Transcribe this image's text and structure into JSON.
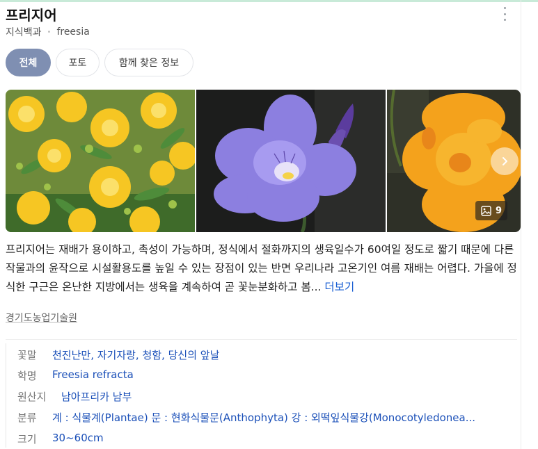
{
  "header": {
    "title": "프리지어",
    "subtitle_source": "지식백과",
    "subtitle_term": "freesia"
  },
  "tabs": [
    {
      "label": "전체",
      "active": true
    },
    {
      "label": "포토",
      "active": false
    },
    {
      "label": "함께 찾은 정보",
      "active": false
    }
  ],
  "gallery": {
    "images": [
      {
        "subject": "yellow freesia bouquet"
      },
      {
        "subject": "purple freesia flower"
      },
      {
        "subject": "orange double freesia"
      }
    ],
    "photo_count": "9",
    "next_icon": "chevron-right-icon",
    "count_icon": "image-icon"
  },
  "description": {
    "text": "프리지어는 재배가 용이하고, 촉성이 가능하며, 정식에서 절화까지의 생육일수가 60여일 정도로 짧기 때문에 다른 작물과의 윤작으로 시설활용도를 높일 수 있는 장점이 있는 반면 우리나라 고온기인 여름 재배는 어렵다. 가을에 정식한 구근은 온난한 지방에서는 생육을 계속하여 곧 꽃눈분화하고 봄...",
    "more_label": "더보기"
  },
  "source": "경기도농업기술원",
  "info": [
    {
      "key": "꽃말",
      "value": "천진난만, 자기자랑, 청함, 당신의 앞날"
    },
    {
      "key": "학명",
      "value": "Freesia refracta"
    },
    {
      "key": "원산지",
      "value": "남아프리카 남부"
    },
    {
      "key": "분류",
      "value": "계 : 식물계(Plantae) 문 : 현화식물문(Anthophyta) 강 : 외떡잎식물강(Monocotyledonea..."
    },
    {
      "key": "크기",
      "value": "30~60cm"
    }
  ],
  "colors": {
    "active_tab": "#7f8fb2",
    "link": "#1a5fd3",
    "info_value": "#1a4fb8"
  }
}
